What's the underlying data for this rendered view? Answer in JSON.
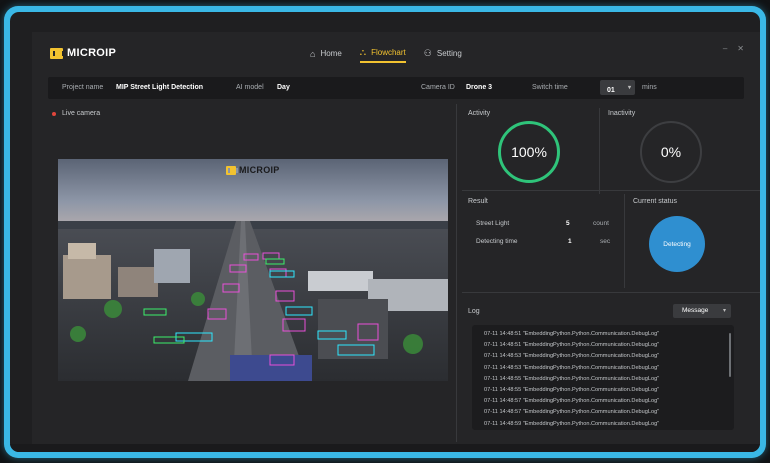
{
  "app": {
    "brand": "MICROIP",
    "window_controls": [
      "–",
      "✕"
    ]
  },
  "nav": {
    "items": [
      {
        "label": "Home",
        "icon": "home-icon",
        "glyph": "⌂",
        "active": false
      },
      {
        "label": "Flowchart",
        "icon": "flowchart-icon",
        "glyph": "⛬",
        "active": true
      },
      {
        "label": "Setting",
        "icon": "user-icon",
        "glyph": "⚇",
        "active": false
      }
    ]
  },
  "info": {
    "project_label": "Project name",
    "project_value": "MIP Street Light Detection",
    "model_label": "AI model",
    "model_value": "Day",
    "camera_label": "Camera ID",
    "camera_value": "Drone 3",
    "switch_label": "Switch time",
    "switch_value": "01",
    "switch_unit": "mins"
  },
  "camera": {
    "title": "Live camera",
    "overlay_brand": "MICROIP"
  },
  "activity": {
    "label": "Activity",
    "value": "100%",
    "level": 1.0
  },
  "inactivity": {
    "label": "Inactivity",
    "value": "0%",
    "level": 0.0
  },
  "result": {
    "label": "Result",
    "rows": [
      {
        "name": "Street Light",
        "value": "5",
        "unit": "count"
      },
      {
        "name": "Detecting time",
        "value": "1",
        "unit": "sec"
      }
    ]
  },
  "status": {
    "label": "Current status",
    "value": "Detecting"
  },
  "log": {
    "label": "Log",
    "filter": "Message",
    "lines": [
      "07-11 14:48:51 \"EmbeddingPython.Python.Communication.DebugLog\"",
      "07-11 14:48:51 \"EmbeddingPython.Python.Communication.DebugLog\"",
      "07-11 14:48:53 \"EmbeddingPython.Python.Communication.DebugLog\"",
      "07-11 14:48:53 \"EmbeddingPython.Python.Communication.DebugLog\"",
      "07-11 14:48:55 \"EmbeddingPython.Python.Communication.DebugLog\"",
      "07-11 14:48:55 \"EmbeddingPython.Python.Communication.DebugLog\"",
      "07-11 14:48:57 \"EmbeddingPython.Python.Communication.DebugLog\"",
      "07-11 14:48:57 \"EmbeddingPython.Python.Communication.DebugLog\"",
      "07-11 14:48:59 \"EmbeddingPython.Python.Communication.DebugLog\""
    ]
  },
  "colors": {
    "accent": "#f2c230",
    "frame": "#3ab8e6",
    "active_gauge": "#2fc47a",
    "status": "#2f8fd0"
  }
}
